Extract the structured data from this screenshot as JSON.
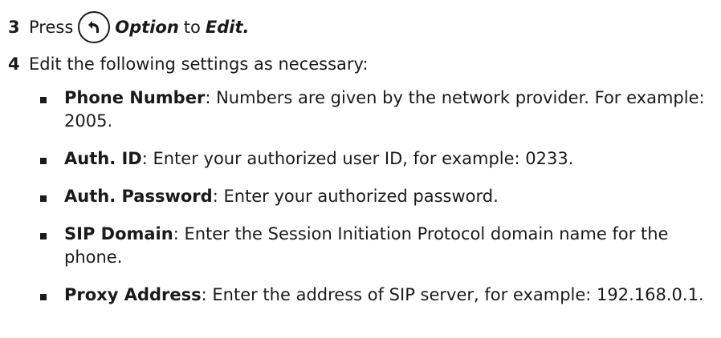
{
  "steps": [
    {
      "number": "3",
      "press_text": "Press",
      "icon": "option-key-icon",
      "option_text": "Option",
      "to_text": "to",
      "edit_text": "Edit."
    },
    {
      "number": "4",
      "text": "Edit the following settings as necessary:"
    }
  ],
  "settings": [
    {
      "term": "Phone Number",
      "desc": ": Numbers are given by the network provider. For example: 2005."
    },
    {
      "term": "Auth. ID",
      "desc": ": Enter your authorized user ID, for example: 0233."
    },
    {
      "term": "Auth. Password",
      "desc": ": Enter your authorized password."
    },
    {
      "term": "SIP Domain",
      "desc": ": Enter the Session Initiation Protocol domain name for the phone."
    },
    {
      "term": "Proxy Address",
      "desc": ": Enter the address of SIP server, for example: 192.168.0.1."
    }
  ]
}
